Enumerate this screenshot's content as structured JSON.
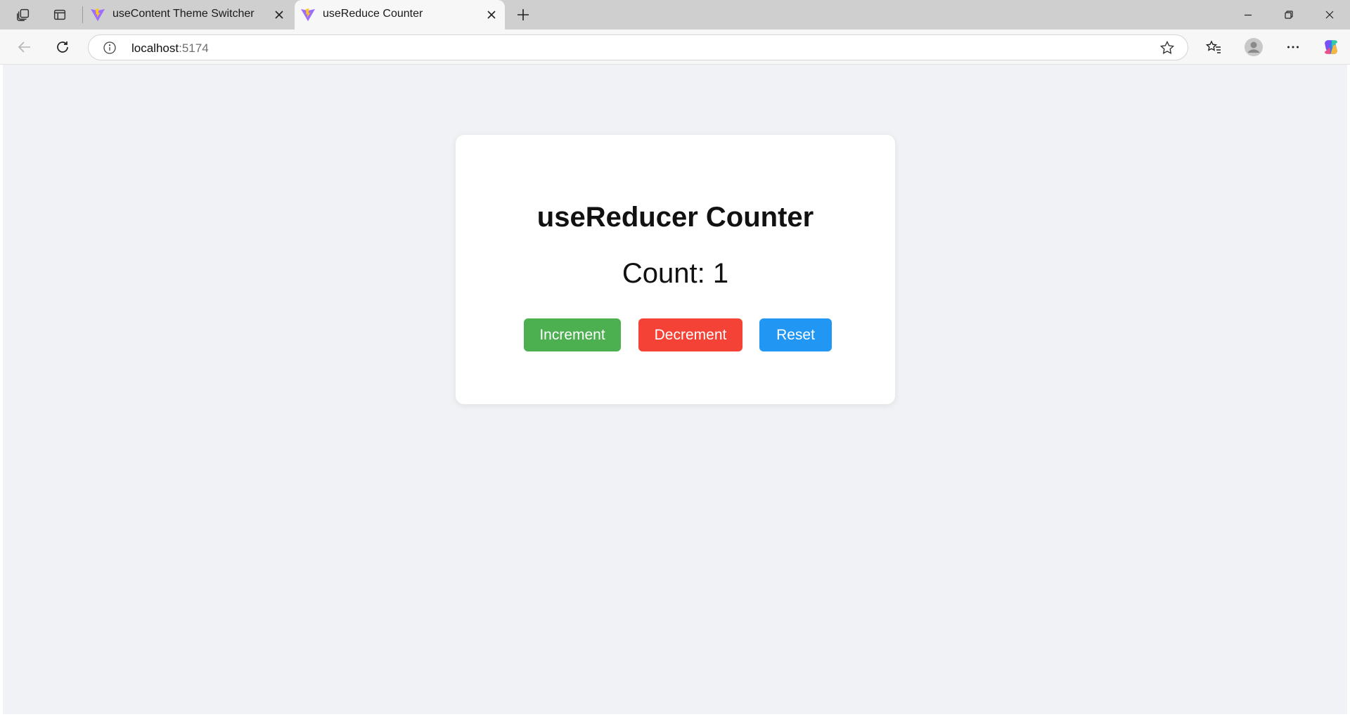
{
  "browser": {
    "tabs": [
      {
        "title": "useContent Theme Switcher",
        "favicon": "vite-logo-icon",
        "active": false
      },
      {
        "title": "useReduce Counter",
        "favicon": "vite-logo-icon",
        "active": true
      }
    ],
    "address": {
      "host": "localhost",
      "port": ":5174"
    },
    "icons": {
      "workspaces": "workspaces-icon",
      "tab_actions": "tab-actions-icon",
      "close_tab": "close-icon",
      "new_tab": "plus-icon",
      "back": "back-arrow-icon",
      "reload": "reload-icon",
      "site_info": "info-icon",
      "favorite": "star-icon",
      "favorites": "favorites-icon",
      "profile": "profile-icon",
      "more": "more-icon",
      "copilot": "copilot-icon"
    }
  },
  "page": {
    "background_color": "#f0f2f5",
    "card": {
      "title": "useReducer Counter",
      "count_text": "Count: 1",
      "count_value": 1
    },
    "buttons": {
      "increment": {
        "label": "Increment",
        "color": "#4caf50"
      },
      "decrement": {
        "label": "Decrement",
        "color": "#f44336"
      },
      "reset": {
        "label": "Reset",
        "color": "#2196f3"
      }
    }
  }
}
